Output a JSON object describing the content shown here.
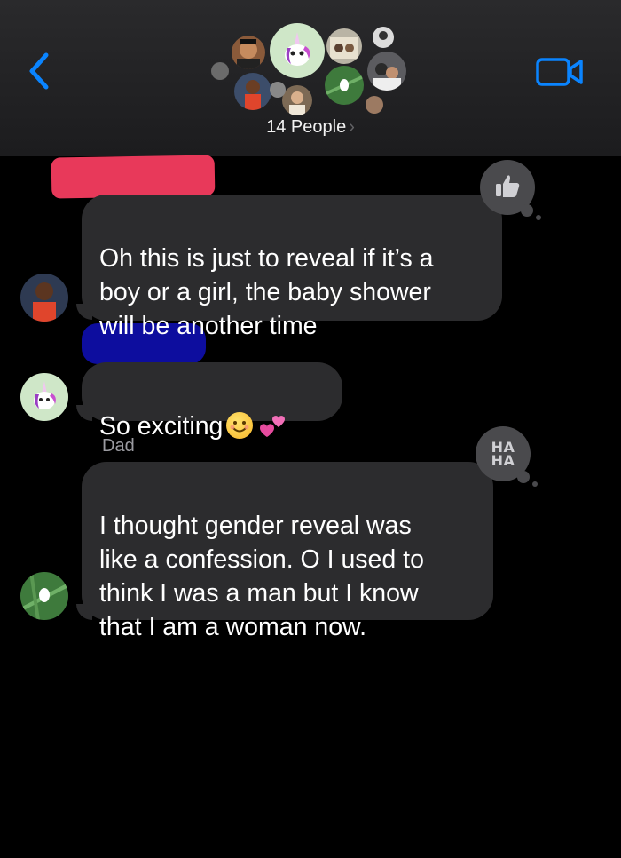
{
  "header": {
    "people_label": "14 People",
    "people_chevron": "›"
  },
  "messages": [
    {
      "sender": "",
      "text": "Oh this is just to reveal if it’s a\nboy or a girl, the baby shower\nwill be another time",
      "tapback": "thumbs-up-icon"
    },
    {
      "sender": "",
      "text": "So exciting",
      "emojis": [
        "smiling-face-emoji",
        "two-hearts-emoji"
      ]
    },
    {
      "sender": "Dad",
      "text": "I thought gender reveal was\nlike a confession.  O I used to\nthink I was a man but I know\nthat I am a woman now.",
      "tapback": "haha-icon",
      "tapback_text": "HA\nHA"
    }
  ],
  "colors": {
    "accent": "#0a84ff",
    "bubble": "#2c2c2e",
    "background": "#000000",
    "redaction_pink": "#e8395a",
    "redaction_blue": "#0d0d9e"
  }
}
